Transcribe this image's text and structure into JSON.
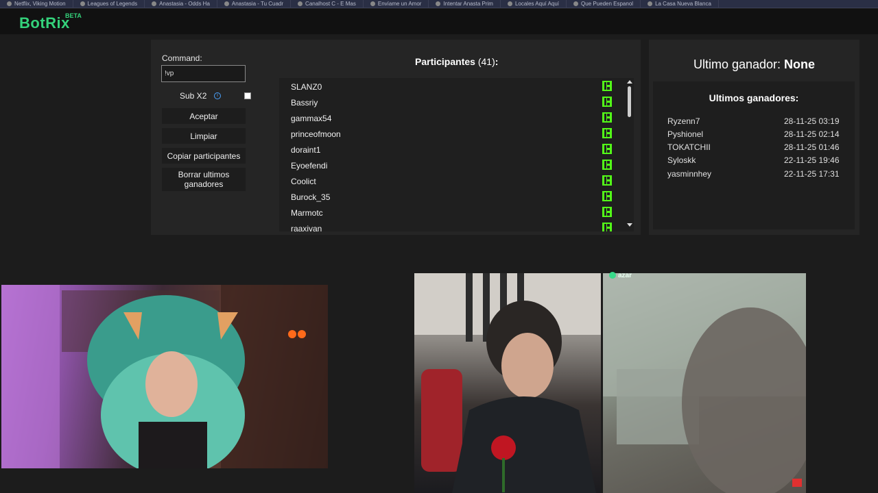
{
  "browser_tabs": [
    "Netflix, Viking Motion",
    "Leagues of Legends",
    "Anastasia - Odds Ha",
    "Anastasia - Tu Cuadr",
    "Canalhost C - E Mas",
    "Envíame un Amor",
    "Intentar Anasta Prim",
    "Locales Aquí Aquí",
    "Que Pueden Espanol",
    "La Casa Nueva Blanca"
  ],
  "app": {
    "logo": "BotRix",
    "badge": "BETA"
  },
  "controls": {
    "command_label": "Command:",
    "command_value": "!vp",
    "sub_x2_label": "Sub X2",
    "sub_x2_checked": false,
    "accept_label": "Aceptar",
    "clear_label": "Limpiar",
    "copy_label": "Copiar participantes",
    "delete_label": "Borrar ultimos ganadores"
  },
  "participants": {
    "title": "Participantes",
    "count": "(41)",
    "suffix": ":",
    "names": [
      "SLANZ0",
      "Bassriy",
      "gammax54",
      "princeofmoon",
      "doraint1",
      "Eyoefendi",
      "Coolict",
      "Burock_35",
      "Marmotc",
      "raaxivan"
    ],
    "platform_icon": "kick-icon"
  },
  "winner": {
    "label": "Ultimo ganador:",
    "value": "None"
  },
  "recent_winners": {
    "title": "Ultimos ganadores:",
    "rows": [
      {
        "name": "Ryzenn7",
        "date": "28-11-25 03:19"
      },
      {
        "name": "Pyshionel",
        "date": "28-11-25 02:14"
      },
      {
        "name": "TOKATCHII",
        "date": "28-11-25 01:46"
      },
      {
        "name": "Syloskk",
        "date": "22-11-25 19:46"
      },
      {
        "name": "yasminnhey",
        "date": "22-11-25 17:31"
      }
    ]
  },
  "overlay": {
    "azar_label": "azar"
  },
  "colors": {
    "brand": "#34d27b",
    "kick": "#53fc18",
    "panel": "#252525",
    "bg": "#1c1c1c"
  }
}
